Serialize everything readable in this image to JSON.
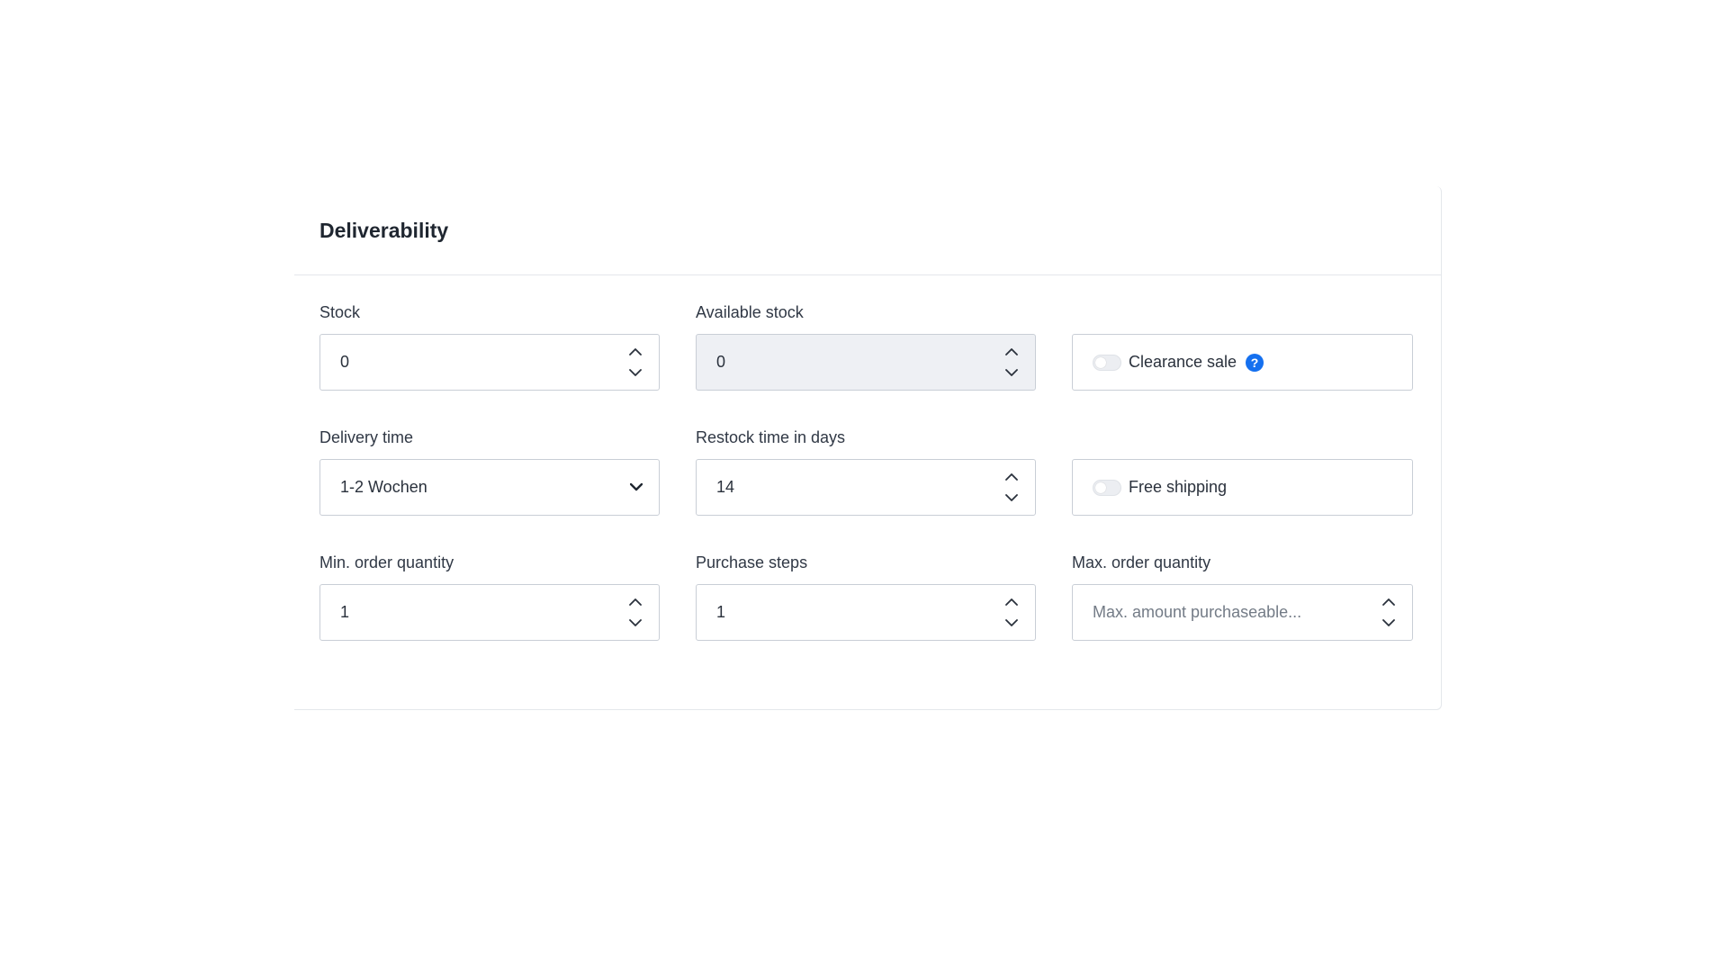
{
  "card": {
    "title": "Deliverability"
  },
  "fields": {
    "stock": {
      "label": "Stock",
      "value": "0"
    },
    "available_stock": {
      "label": "Available stock",
      "value": "0"
    },
    "clearance_sale": {
      "label": "Clearance sale",
      "checked": false,
      "help_icon": "question-circle-icon",
      "help_glyph": "?"
    },
    "delivery_time": {
      "label": "Delivery time",
      "value": "1-2 Wochen"
    },
    "restock_time": {
      "label": "Restock time in days",
      "value": "14"
    },
    "free_shipping": {
      "label": "Free shipping",
      "checked": false
    },
    "min_order_quantity": {
      "label": "Min. order quantity",
      "value": "1"
    },
    "purchase_steps": {
      "label": "Purchase steps",
      "value": "1"
    },
    "max_order_quantity": {
      "label": "Max. order quantity",
      "placeholder": "Max. amount purchaseable..."
    }
  },
  "colors": {
    "accent": "#1570ef",
    "border": "#c9ced6",
    "disabled_bg": "#eef0f4"
  }
}
